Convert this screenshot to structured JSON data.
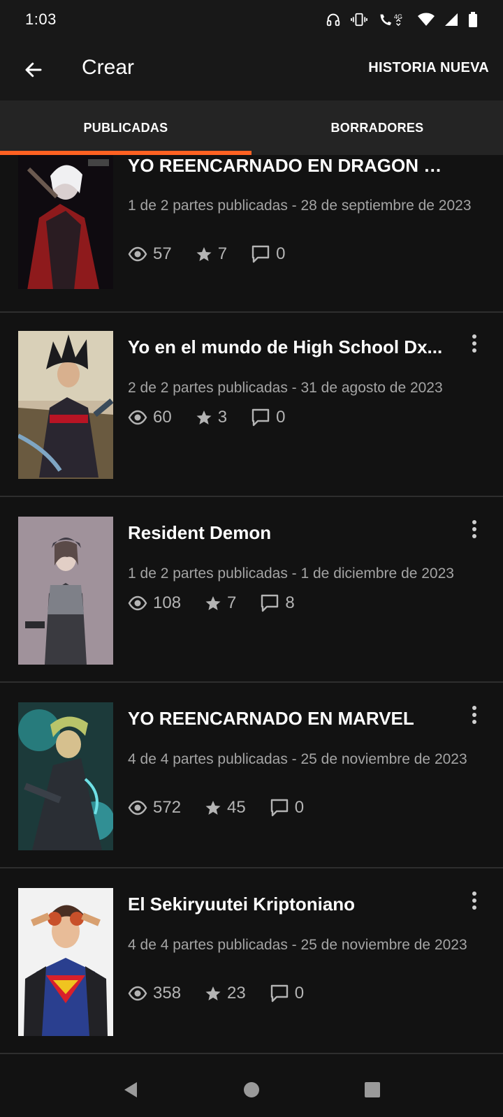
{
  "status": {
    "time": "1:03",
    "icons": [
      "headphones-icon",
      "vibrate-icon",
      "wifi-calling-icon",
      "4g-icon",
      "wifi-icon",
      "signal-icon",
      "battery-icon"
    ]
  },
  "app_bar": {
    "title": "Crear",
    "action_label": "HISTORIA NUEVA"
  },
  "tabs": [
    {
      "label": "PUBLICADAS",
      "active": true
    },
    {
      "label": "BORRADORES",
      "active": false
    }
  ],
  "colors": {
    "accent": "#ff6122",
    "background": "#121212",
    "tab_bg": "#242424"
  },
  "stories": [
    {
      "title": "YO REENCARNADO EN DRAGON B...",
      "meta": "1 de 2 partes publicadas - 28 de septiembre de 2023",
      "views": "57",
      "votes": "7",
      "comments": "0"
    },
    {
      "title": "Yo en el mundo de High School Dx...",
      "meta": "2 de 2 partes publicadas - 31 de agosto de 2023",
      "views": "60",
      "votes": "3",
      "comments": "0"
    },
    {
      "title": "Resident Demon",
      "meta": "1 de 2 partes publicadas - 1 de diciembre de 2023",
      "views": "108",
      "votes": "7",
      "comments": "8"
    },
    {
      "title": "YO REENCARNADO EN MARVEL",
      "meta": "4 de 4 partes publicadas - 25 de noviembre de 2023",
      "views": "572",
      "votes": "45",
      "comments": "0"
    },
    {
      "title": "El Sekiryuutei  Kriptoniano",
      "meta": "4 de 4 partes publicadas - 25 de noviembre de 2023",
      "views": "358",
      "votes": "23",
      "comments": "0"
    }
  ],
  "nav": {
    "icons": [
      "back-triangle-icon",
      "home-circle-icon",
      "recents-square-icon"
    ]
  }
}
